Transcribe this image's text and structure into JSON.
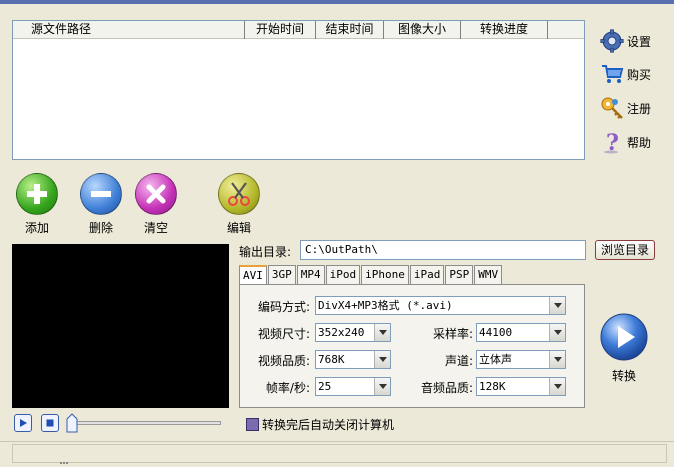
{
  "file_list": {
    "columns": [
      "源文件路径",
      "开始时间",
      "结束时间",
      "图像大小",
      "转换进度"
    ]
  },
  "side_menu": {
    "settings": "设置",
    "buy": "购买",
    "register": "注册",
    "help": "帮助"
  },
  "toolbar": {
    "add": "添加",
    "delete": "删除",
    "clear": "清空",
    "edit": "编辑"
  },
  "output": {
    "label": "输出目录:",
    "path": "C:\\OutPath\\",
    "browse": "浏览目录"
  },
  "tabs": [
    "AVI",
    "3GP",
    "MP4",
    "iPod",
    "iPhone",
    "iPad",
    "PSP",
    "WMV"
  ],
  "settings": {
    "encoding_label": "编码方式:",
    "encoding_value": "DivX4+MP3格式 (*.avi)",
    "size_label": "视频尺寸:",
    "size_value": "352x240",
    "sample_rate_label": "采样率:",
    "sample_rate_value": "44100",
    "quality_label": "视频品质:",
    "quality_value": "768K",
    "channel_label": "声道:",
    "channel_value": "立体声",
    "fps_label": "帧率/秒:",
    "fps_value": "25",
    "audio_quality_label": "音频品质:",
    "audio_quality_value": "128K"
  },
  "convert": {
    "label": "转换"
  },
  "shutdown": {
    "label": "转换完后自动关闭计算机"
  }
}
